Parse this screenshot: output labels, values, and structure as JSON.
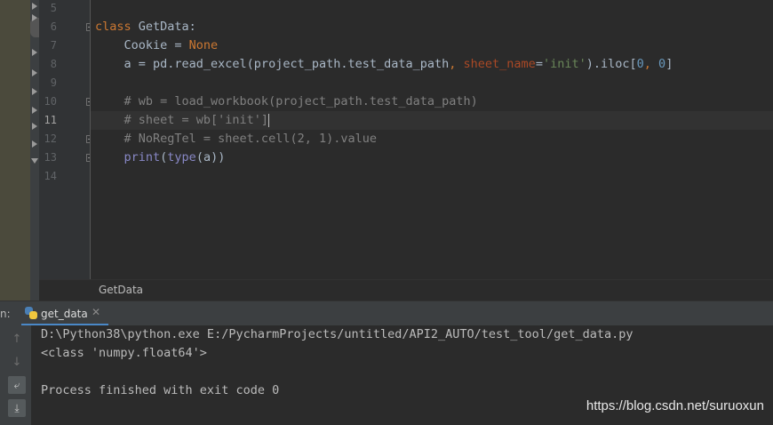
{
  "editor": {
    "line_numbers": [
      "5",
      "6",
      "7",
      "8",
      "9",
      "10",
      "11",
      "12",
      "13",
      "14"
    ],
    "current_line": "11",
    "lines": {
      "l6": {
        "kw": "class",
        "rest": " GetData:"
      },
      "l7": {
        "a": "    Cookie = ",
        "kw": "None"
      },
      "l8": {
        "a": "    a = pd.read_excel(project_path.test_data_path",
        "comma": ", ",
        "param": "sheet_name",
        "eq": "=",
        "str": "'init'",
        "b": ").iloc[",
        "n1": "0",
        "c": ", ",
        "n2": "0",
        "d": "]"
      },
      "l10": {
        "cmt": "    # wb = load_workbook(project_path.test_data_path)"
      },
      "l11": {
        "cmt": "    # sheet = wb['init']"
      },
      "l12": {
        "cmt": "    # NoRegTel = sheet.cell(2, 1).value"
      },
      "l13": {
        "indent": "    ",
        "fn1": "print",
        "p1": "(",
        "fn2": "type",
        "p2": "(a))"
      }
    }
  },
  "breadcrumb": {
    "label": "GetData"
  },
  "run_window": {
    "label": "n:",
    "tab_label": "get_data",
    "close_glyph": "✕",
    "toolbar": {
      "up_glyph": "↑",
      "down_glyph": "↓",
      "wrap_glyph": "⤶",
      "scroll_glyph": "⤓"
    },
    "console_lines": [
      "D:\\Python38\\python.exe E:/PycharmProjects/untitled/API2_AUTO/test_tool/get_data.py",
      "<class 'numpy.float64'>",
      "",
      "Process finished with exit code 0"
    ]
  },
  "watermark": "https://blog.csdn.net/suruoxun",
  "colors": {
    "keyword": "#cc7832",
    "builtin": "#8888c6",
    "string": "#6a8759",
    "number": "#6897bb",
    "param": "#aa4926",
    "comment": "#808080",
    "text": "#a9b7c6",
    "background": "#2b2b2b",
    "tab_accent": "#4a88c7"
  },
  "icons": [
    "fold-marker-icon",
    "python-file-icon",
    "close-icon",
    "arrow-up-icon",
    "arrow-down-icon",
    "soft-wrap-icon",
    "scroll-to-end-icon",
    "tree-expand-icon"
  ]
}
